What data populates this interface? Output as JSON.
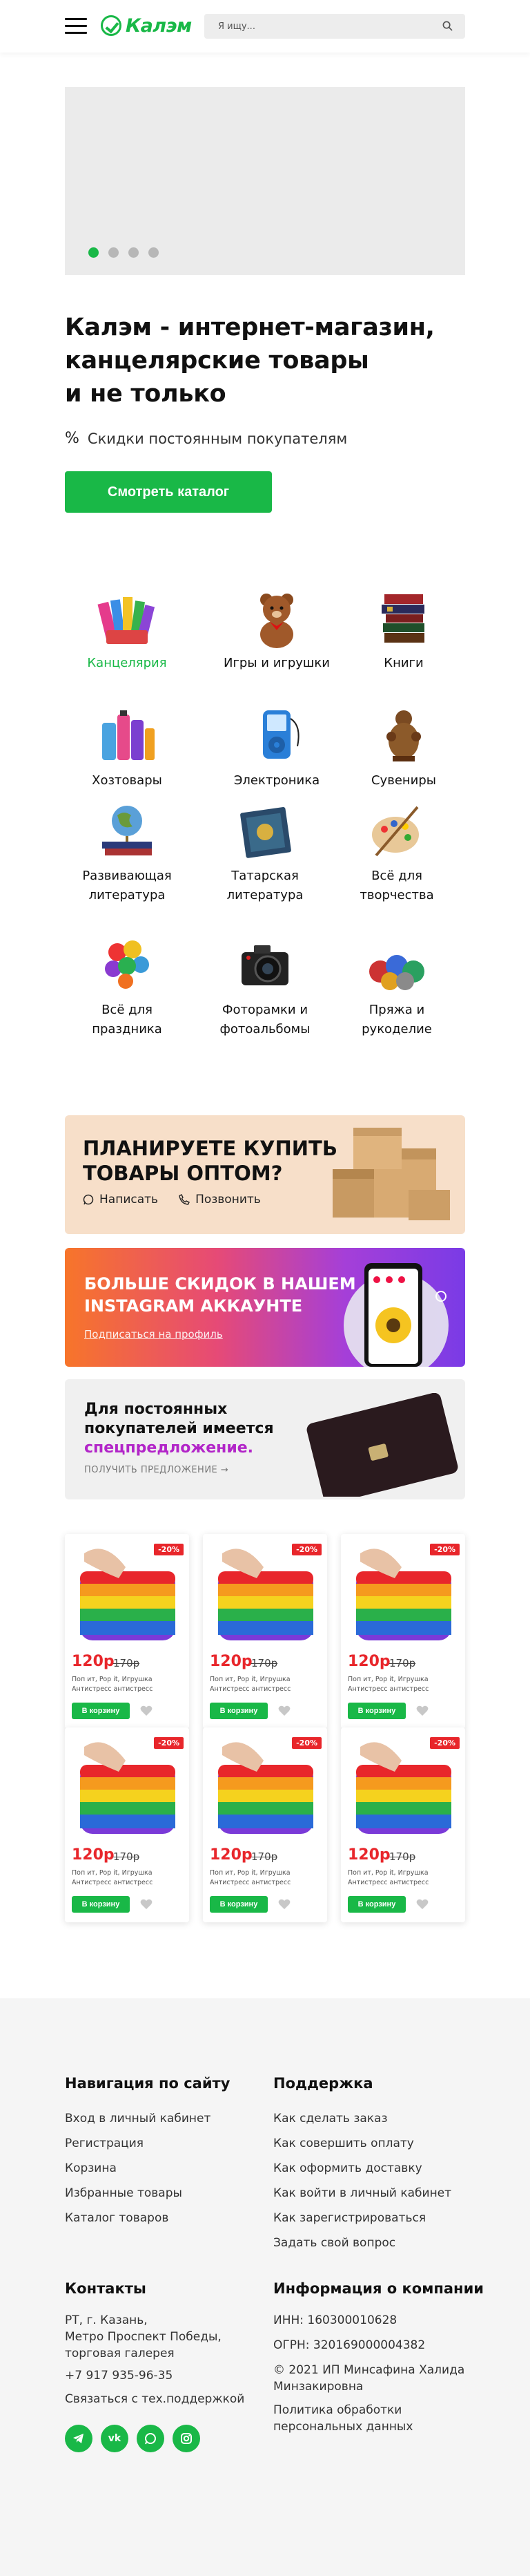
{
  "header": {
    "logo_text": "Калэм",
    "search_placeholder": "Я ищу..."
  },
  "banner": {
    "slides": 4,
    "active_slide": 1
  },
  "hero": {
    "title_line1": "Калэм - интернет-магазин,",
    "title_line2": "канцелярские товары",
    "title_line3": "и не только",
    "discount_text": "Скидки постоянным покупателям",
    "cta_label": "Смотреть каталог"
  },
  "categories": [
    {
      "line1": "Канцелярия",
      "line2": "",
      "icon": "stationery-icon",
      "active": true
    },
    {
      "line1": "Игры и игрушки",
      "line2": "",
      "icon": "teddy-bear-icon",
      "active": false
    },
    {
      "line1": "Книги",
      "line2": "",
      "icon": "books-icon",
      "active": false
    },
    {
      "line1": "Хозтовары",
      "line2": "",
      "icon": "household-icon",
      "active": false
    },
    {
      "line1": "Электроника",
      "line2": "",
      "icon": "mp3-player-icon",
      "active": false
    },
    {
      "line1": "Сувениры",
      "line2": "",
      "icon": "figurine-icon",
      "active": false
    },
    {
      "line1": "Развивающая",
      "line2": "литература",
      "icon": "globe-icon",
      "active": false
    },
    {
      "line1": "Татарская",
      "line2": "литература",
      "icon": "book-icon",
      "active": false
    },
    {
      "line1": "Всё для",
      "line2": "творчества",
      "icon": "palette-icon",
      "active": false
    },
    {
      "line1": "Всё для",
      "line2": "праздника",
      "icon": "balloons-icon",
      "active": false
    },
    {
      "line1": "Фоторамки и",
      "line2": "фотоальбомы",
      "icon": "camera-icon",
      "active": false
    },
    {
      "line1": "Пряжа и",
      "line2": "рукоделие",
      "icon": "yarn-icon",
      "active": false
    }
  ],
  "promos": {
    "wholesale": {
      "line1": "ПЛАНИРУЕТЕ КУПИТЬ",
      "line2": "ТОВАРЫ ОПТОМ?",
      "write_label": "Написать",
      "call_label": "Позвонить"
    },
    "instagram": {
      "line1": "БОЛЬШЕ СКИДОК В НАШЕМ",
      "line2": "INSTAGRAM АККАУНТЕ",
      "link_label": "Подписаться на профиль"
    },
    "loyalty": {
      "line1": "Для постоянных",
      "line2": "покупателей имеется",
      "highlight": "спецпредложение.",
      "link_label": "ПОЛУЧИТЬ ПРЕДЛОЖЕНИЕ →"
    }
  },
  "products": [
    {
      "badge": "-20%",
      "price": "120р",
      "old_price": "170р",
      "desc": "Поп ит, Pop it, Игрушка Антистресс антистресс тактильная игрушка",
      "buy_label": "В корзину"
    },
    {
      "badge": "-20%",
      "price": "120р",
      "old_price": "170р",
      "desc": "Поп ит, Pop it, Игрушка Антистресс антистресс тактильная игрушка",
      "buy_label": "В корзину"
    },
    {
      "badge": "-20%",
      "price": "120р",
      "old_price": "170р",
      "desc": "Поп ит, Pop it, Игрушка Антистресс антистресс тактильная игрушка",
      "buy_label": "В корзину"
    },
    {
      "badge": "-20%",
      "price": "120р",
      "old_price": "170р",
      "desc": "Поп ит, Pop it, Игрушка Антистресс антистресс тактильная игрушка",
      "buy_label": "В корзину"
    },
    {
      "badge": "-20%",
      "price": "120р",
      "old_price": "170р",
      "desc": "Поп ит, Pop it, Игрушка Антистресс антистресс тактильная игрушка",
      "buy_label": "В корзину"
    },
    {
      "badge": "-20%",
      "price": "120р",
      "old_price": "170р",
      "desc": "Поп ит, Pop it, Игрушка Антистресс антистресс тактильная игрушка",
      "buy_label": "В корзину"
    }
  ],
  "footer": {
    "nav_title": "Навигация по сайту",
    "nav_links": [
      "Вход в личный кабинет",
      "Регистрация",
      "Корзина",
      "Избранные товары",
      "Каталог товаров"
    ],
    "support_title": "Поддержка",
    "support_links": [
      "Как сделать заказ",
      "Как совершить оплату",
      "Как оформить доставку",
      "Как войти в личный кабинет",
      "Как зарегистрироваться",
      "Задать свой вопрос"
    ],
    "contacts_title": "Контакты",
    "address_line1": "РТ, г. Казань,",
    "address_line2": "Метро Проспект Победы,",
    "address_line3": "торговая галерея",
    "phone": "+7 917 935-96-35",
    "support_contact": "Связаться с тех.поддержкой",
    "company_title": "Информация о компании",
    "inn": "ИНН: 160300010628",
    "ogrn": "ОГРН: 320169000004382",
    "copyright_line1": "© 2021 ИП Минсафина Халида",
    "copyright_line2": "Минзакировна",
    "privacy_line1": "Политика обработки",
    "privacy_line2": "персональных данных",
    "socials": [
      "telegram-icon",
      "vk-icon",
      "whatsapp-icon",
      "instagram-icon"
    ]
  },
  "colors": {
    "accent": "#19b847",
    "price": "#e8262b",
    "highlight": "#b225c8"
  }
}
